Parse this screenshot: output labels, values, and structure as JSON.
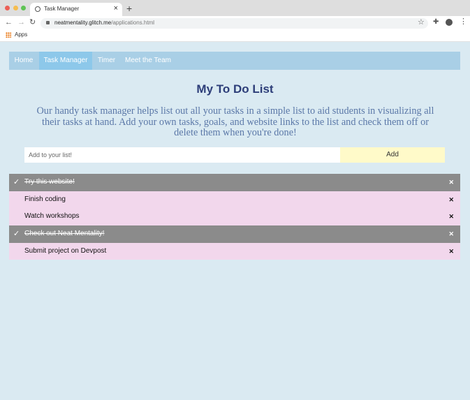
{
  "browser": {
    "tab_title": "Task Manager",
    "url_host": "neatmentality.glitch.me",
    "url_path": "/applications.html",
    "bookmark_apps": "Apps"
  },
  "nav": {
    "items": [
      {
        "label": "Home",
        "active": false
      },
      {
        "label": "Task Manager",
        "active": true
      },
      {
        "label": "Timer",
        "active": false
      },
      {
        "label": "Meet the Team",
        "active": false
      }
    ]
  },
  "page": {
    "title": "My To Do List",
    "intro": "Our handy task manager helps list out all your tasks in a simple list to aid students in visualizing all their tasks at hand. Add your own tasks, goals, and website links to the list and check them off or delete them when you're done!"
  },
  "form": {
    "placeholder": "Add to your list!",
    "add_label": "Add"
  },
  "tasks": [
    {
      "text": "Try this website!",
      "checked": true
    },
    {
      "text": "Finish coding",
      "checked": false
    },
    {
      "text": "Watch workshops",
      "checked": false
    },
    {
      "text": "Check out Neat Mentality!",
      "checked": true
    },
    {
      "text": "Submit project on Devpost",
      "checked": false
    }
  ],
  "colors": {
    "background": "#daeaf2",
    "navbar": "#a9cfe6",
    "nav_active": "#8dc8ea",
    "title": "#2d3e79",
    "intro_text": "#5b78a8",
    "add_button": "#fffac9",
    "task_pending": "#f2d7ec",
    "task_checked": "#8b8b8b"
  },
  "icons": {
    "check": "checkmark-icon",
    "delete": "close-icon"
  }
}
